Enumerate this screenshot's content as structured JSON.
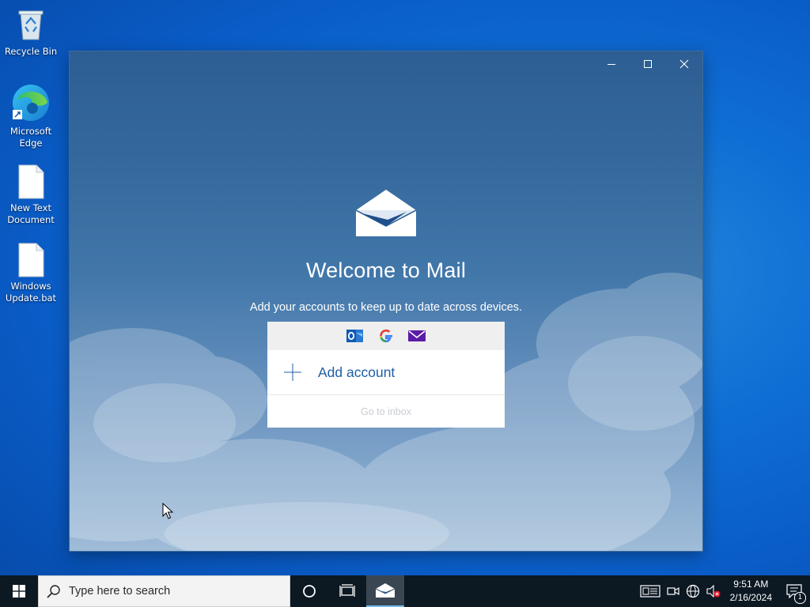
{
  "desktop": {
    "icons": [
      {
        "label": "Recycle Bin",
        "icon": "recycle-bin-icon"
      },
      {
        "label": "Microsoft Edge",
        "icon": "edge-icon"
      },
      {
        "label": "New Text Document",
        "icon": "text-document-icon"
      },
      {
        "label": "Windows Update.bat",
        "icon": "batch-file-icon"
      }
    ]
  },
  "mail": {
    "title": "Welcome to Mail",
    "subtitle": "Add your accounts to keep up to date across devices.",
    "providers": [
      "outlook-icon",
      "google-icon",
      "yahoo-mail-icon"
    ],
    "add_account_label": "Add account",
    "goto_inbox_label": "Go to inbox",
    "accent_color": "#1f5fa6"
  },
  "window_controls": [
    "minimize-icon",
    "maximize-icon",
    "close-icon"
  ],
  "taskbar": {
    "search_placeholder": "Type here to search",
    "time": "9:51 AM",
    "date": "2/16/2024",
    "notification_count": "1",
    "background": "#0c1822"
  }
}
